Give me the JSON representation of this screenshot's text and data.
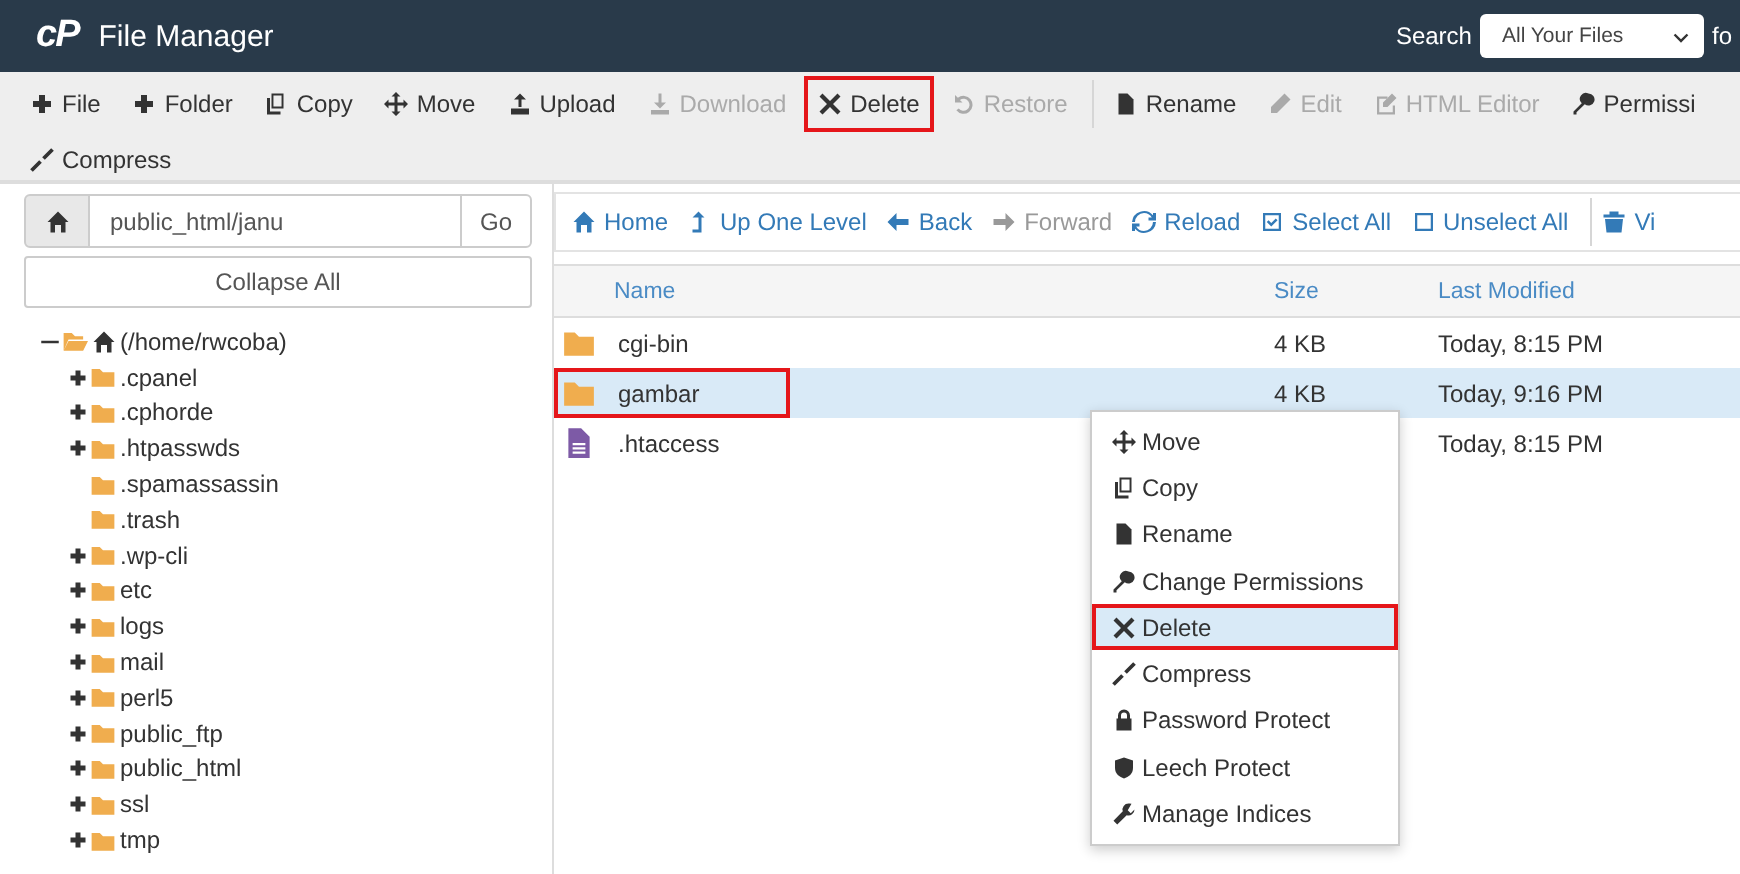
{
  "header": {
    "logo": "cP",
    "title": "File Manager",
    "search_label": "Search",
    "search_scope": "All Your Files",
    "search_for_label": "fo"
  },
  "toolbar": [
    {
      "label": "File",
      "disabled": false,
      "annotated": false
    },
    {
      "label": "Folder",
      "disabled": false,
      "annotated": false
    },
    {
      "label": "Copy",
      "disabled": false,
      "annotated": false
    },
    {
      "label": "Move",
      "disabled": false,
      "annotated": false
    },
    {
      "label": "Upload",
      "disabled": false,
      "annotated": false
    },
    {
      "label": "Download",
      "disabled": true,
      "annotated": false
    },
    {
      "label": "Delete",
      "disabled": false,
      "annotated": true
    },
    {
      "label": "Restore",
      "disabled": true,
      "annotated": false
    },
    {
      "label": "Rename",
      "disabled": false,
      "annotated": false
    },
    {
      "label": "Edit",
      "disabled": true,
      "annotated": false
    },
    {
      "label": "HTML Editor",
      "disabled": true,
      "annotated": false
    },
    {
      "label": "Permissi",
      "disabled": false,
      "annotated": false
    },
    {
      "label": "Compress",
      "disabled": false,
      "annotated": false
    }
  ],
  "path_bar": {
    "value": "public_html/janu",
    "go": "Go"
  },
  "collapse_all": "Collapse All",
  "tree": [
    {
      "label": "(/home/rwcoba)",
      "expandable": true,
      "expanded": true,
      "children": [
        {
          "label": ".cpanel",
          "expandable": true,
          "expanded": false
        },
        {
          "label": ".cphorde",
          "expandable": true,
          "expanded": false
        },
        {
          "label": ".htpasswds",
          "expandable": true,
          "expanded": false
        },
        {
          "label": ".spamassassin",
          "expandable": false,
          "expanded": false
        },
        {
          "label": ".trash",
          "expandable": false,
          "expanded": false
        },
        {
          "label": ".wp-cli",
          "expandable": true,
          "expanded": false
        },
        {
          "label": "etc",
          "expandable": true,
          "expanded": false
        },
        {
          "label": "logs",
          "expandable": true,
          "expanded": false
        },
        {
          "label": "mail",
          "expandable": true,
          "expanded": false
        },
        {
          "label": "perl5",
          "expandable": true,
          "expanded": false
        },
        {
          "label": "public_ftp",
          "expandable": true,
          "expanded": false
        },
        {
          "label": "public_html",
          "expandable": true,
          "expanded": false
        },
        {
          "label": "ssl",
          "expandable": true,
          "expanded": false
        },
        {
          "label": "tmp",
          "expandable": true,
          "expanded": false
        }
      ]
    }
  ],
  "nav": [
    {
      "label": "Home",
      "disabled": false
    },
    {
      "label": "Up One Level",
      "disabled": false
    },
    {
      "label": "Back",
      "disabled": false
    },
    {
      "label": "Forward",
      "disabled": true
    },
    {
      "label": "Reload",
      "disabled": false
    },
    {
      "label": "Select All",
      "disabled": false
    },
    {
      "label": "Unselect All",
      "disabled": false
    },
    {
      "label": "Vi",
      "disabled": false
    }
  ],
  "table": {
    "columns": [
      "Name",
      "Size",
      "Last Modified"
    ],
    "rows": [
      {
        "kind": "folder",
        "name": "cgi-bin",
        "size": "4 KB",
        "modified": "Today, 8:15 PM",
        "selected": false,
        "annotated": false
      },
      {
        "kind": "folder",
        "name": "gambar",
        "size": "4 KB",
        "modified": "Today, 9:16 PM",
        "selected": true,
        "annotated": true
      },
      {
        "kind": "file",
        "name": ".htaccess",
        "size": "",
        "modified": "Today, 8:15 PM",
        "selected": false,
        "annotated": false
      }
    ]
  },
  "context_menu": [
    {
      "label": "Move",
      "selected": false,
      "annotated": false
    },
    {
      "label": "Copy",
      "selected": false,
      "annotated": false
    },
    {
      "label": "Rename",
      "selected": false,
      "annotated": false
    },
    {
      "label": "Change Permissions",
      "selected": false,
      "annotated": false
    },
    {
      "label": "Delete",
      "selected": true,
      "annotated": true
    },
    {
      "label": "Compress",
      "selected": false,
      "annotated": false
    },
    {
      "label": "Password Protect",
      "selected": false,
      "annotated": false
    },
    {
      "label": "Leech Protect",
      "selected": false,
      "annotated": false
    },
    {
      "label": "Manage Indices",
      "selected": false,
      "annotated": false
    }
  ]
}
